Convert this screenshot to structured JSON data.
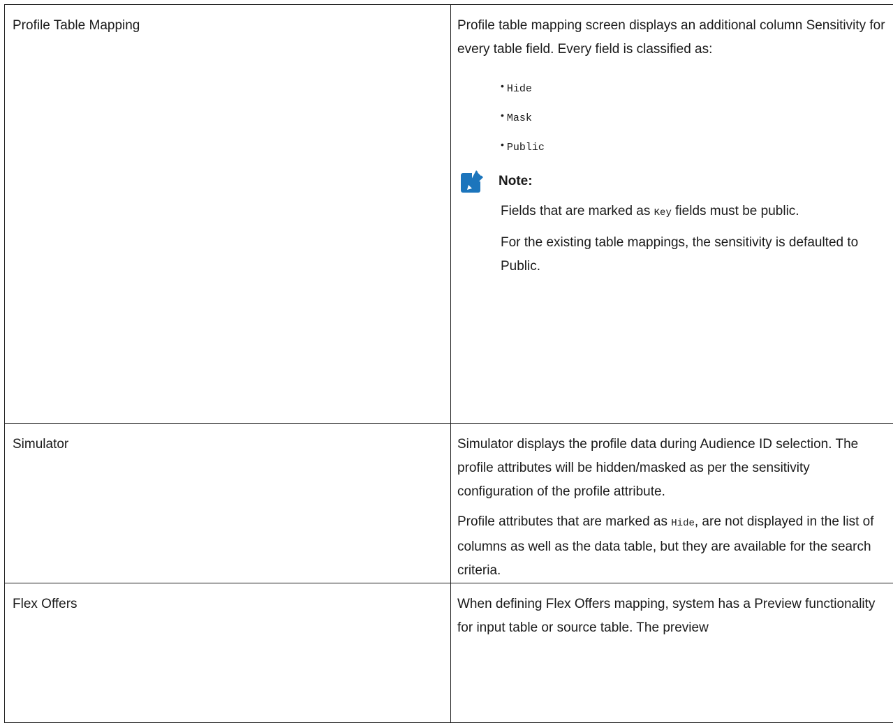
{
  "rows": [
    {
      "label": "Profile Table Mapping",
      "intro": "Profile table mapping screen displays an additional column Sensitivity for every table field. Every field is classified as:",
      "options": [
        "Hide",
        "Mask",
        "Public"
      ],
      "note": {
        "title": "Note:",
        "line1_before": "Fields that are marked as ",
        "line1_code": "Key",
        "line1_after": " fields must be public.",
        "line2": "For the existing table mappings, the sensitivity is defaulted to Public."
      }
    },
    {
      "label": "Simulator",
      "para1": "Simulator displays the profile data during Audience ID selection. The profile attributes will be hidden/masked as per the sensitivity configuration of the profile attribute.",
      "para2_before": "Profile attributes that are marked as ",
      "para2_code": "Hide",
      "para2_after": ", are not displayed in the list of columns as well as the data table, but they are available for the search criteria."
    },
    {
      "label": "Flex Offers",
      "para1": "When defining Flex Offers mapping, system has a Preview functionality for input table or source table. The preview"
    }
  ],
  "colors": {
    "note_icon": "#1c75bc",
    "border": "#1f1f1f",
    "text": "#1a1a1a"
  },
  "icons": {
    "note": "pencil-note-icon"
  }
}
